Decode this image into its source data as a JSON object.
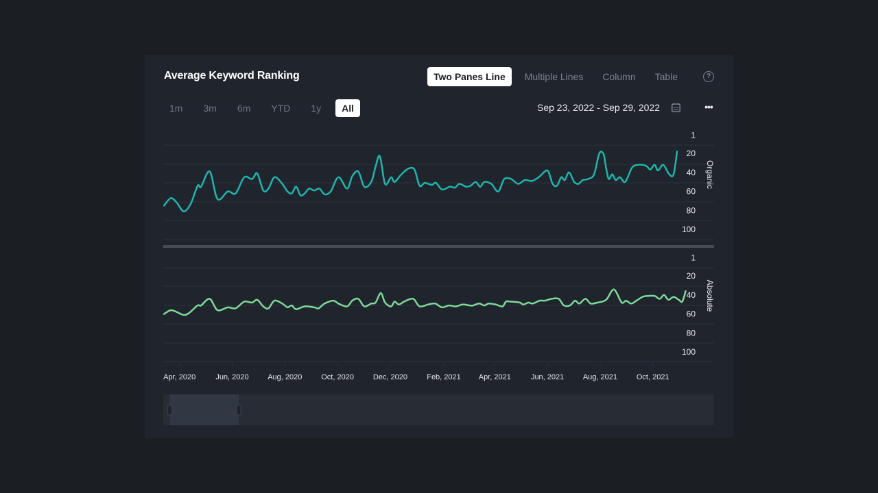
{
  "card": {
    "title": "Average Keyword Ranking",
    "view_tabs": [
      {
        "label": "Two Panes Line",
        "active": true
      },
      {
        "label": "Multiple Lines",
        "active": false
      },
      {
        "label": "Column",
        "active": false
      },
      {
        "label": "Table",
        "active": false
      }
    ],
    "help_icon": "?",
    "range_tabs": [
      {
        "label": "1m",
        "active": false
      },
      {
        "label": "3m",
        "active": false
      },
      {
        "label": "6m",
        "active": false
      },
      {
        "label": "YTD",
        "active": false
      },
      {
        "label": "1y",
        "active": false
      },
      {
        "label": "All",
        "active": true
      }
    ],
    "date_range": "Sep 23, 2022 - Sep 29, 2022",
    "more_icon": "•••"
  },
  "colors": {
    "organic": "#1fb5ad",
    "absolute": "#7ed99a",
    "grid": "#2c313b",
    "separator": "#464b5a",
    "navigator_bg": "#272c35",
    "navigator_window": "#323843"
  },
  "chart_data": {
    "type": "line",
    "title": "Average Keyword Ranking",
    "x_range": [
      "2020-03-14",
      "2021-10-29"
    ],
    "x_ticks": [
      "Apr, 2020",
      "Jun, 2020",
      "Aug, 2020",
      "Oct, 2020",
      "Dec, 2020",
      "Feb, 2021",
      "Apr, 2021",
      "Jun, 2021",
      "Aug, 2021",
      "Oct, 2021"
    ],
    "x_tick_dates": [
      "2020-04-01",
      "2020-06-01",
      "2020-08-01",
      "2020-10-01",
      "2020-12-01",
      "2021-02-01",
      "2021-04-01",
      "2021-06-01",
      "2021-08-01",
      "2021-10-01"
    ],
    "grid": true,
    "navigator": {
      "window_start_fraction": 0.012,
      "window_end_fraction": 0.137
    },
    "panes": [
      {
        "name": "Organic",
        "ylabel": "Organic",
        "y_reversed": true,
        "y_ticks": [
          1,
          20,
          40,
          60,
          80,
          100
        ],
        "ylim": [
          1,
          100
        ],
        "series": {
          "name": "Organic",
          "points": [
            [
              "2020-03-14",
              75
            ],
            [
              "2020-03-22",
              67
            ],
            [
              "2020-03-29",
              72
            ],
            [
              "2020-04-06",
              81
            ],
            [
              "2020-04-14",
              73
            ],
            [
              "2020-04-22",
              54
            ],
            [
              "2020-04-26",
              55
            ],
            [
              "2020-05-06",
              39
            ],
            [
              "2020-05-15",
              68
            ],
            [
              "2020-05-27",
              60
            ],
            [
              "2020-06-05",
              62
            ],
            [
              "2020-06-15",
              45
            ],
            [
              "2020-06-24",
              47
            ],
            [
              "2020-06-30",
              41
            ],
            [
              "2020-07-07",
              59
            ],
            [
              "2020-07-13",
              57
            ],
            [
              "2020-07-20",
              45
            ],
            [
              "2020-07-29",
              52
            ],
            [
              "2020-08-04",
              60
            ],
            [
              "2020-08-09",
              62
            ],
            [
              "2020-08-14",
              55
            ],
            [
              "2020-08-19",
              64
            ],
            [
              "2020-08-24",
              62
            ],
            [
              "2020-08-29",
              57
            ],
            [
              "2020-09-04",
              59
            ],
            [
              "2020-09-10",
              57
            ],
            [
              "2020-09-16",
              63
            ],
            [
              "2020-09-23",
              60
            ],
            [
              "2020-10-02",
              45
            ],
            [
              "2020-10-12",
              57
            ],
            [
              "2020-10-18",
              44
            ],
            [
              "2020-10-25",
              39
            ],
            [
              "2020-11-01",
              55
            ],
            [
              "2020-11-09",
              50
            ],
            [
              "2020-11-14",
              34
            ],
            [
              "2020-11-19",
              23
            ],
            [
              "2020-11-25",
              52
            ],
            [
              "2020-12-02",
              45
            ],
            [
              "2020-12-06",
              50
            ],
            [
              "2020-12-14",
              42
            ],
            [
              "2020-12-22",
              36
            ],
            [
              "2020-12-29",
              37
            ],
            [
              "2021-01-04",
              54
            ],
            [
              "2021-01-10",
              51
            ],
            [
              "2021-01-18",
              53
            ],
            [
              "2021-01-23",
              51
            ],
            [
              "2021-01-30",
              58
            ],
            [
              "2021-02-08",
              55
            ],
            [
              "2021-02-14",
              56
            ],
            [
              "2021-02-19",
              52
            ],
            [
              "2021-02-27",
              55
            ],
            [
              "2021-03-04",
              54
            ],
            [
              "2021-03-10",
              50
            ],
            [
              "2021-03-15",
              55
            ],
            [
              "2021-03-20",
              50
            ],
            [
              "2021-03-28",
              52
            ],
            [
              "2021-04-05",
              60
            ],
            [
              "2021-04-12",
              47
            ],
            [
              "2021-04-20",
              47
            ],
            [
              "2021-04-28",
              52
            ],
            [
              "2021-05-06",
              48
            ],
            [
              "2021-05-14",
              49
            ],
            [
              "2021-05-22",
              45
            ],
            [
              "2021-05-29",
              39
            ],
            [
              "2021-06-02",
              39
            ],
            [
              "2021-06-07",
              52
            ],
            [
              "2021-06-12",
              54
            ],
            [
              "2021-06-17",
              45
            ],
            [
              "2021-06-21",
              48
            ],
            [
              "2021-06-26",
              40
            ],
            [
              "2021-07-02",
              50
            ],
            [
              "2021-07-07",
              52
            ],
            [
              "2021-07-12",
              48
            ],
            [
              "2021-07-18",
              47
            ],
            [
              "2021-07-25",
              42
            ],
            [
              "2021-07-31",
              20
            ],
            [
              "2021-08-05",
              21
            ],
            [
              "2021-08-08",
              36
            ],
            [
              "2021-08-11",
              47
            ],
            [
              "2021-08-15",
              42
            ],
            [
              "2021-08-19",
              48
            ],
            [
              "2021-08-24",
              45
            ],
            [
              "2021-08-30",
              50
            ],
            [
              "2021-09-07",
              35
            ],
            [
              "2021-09-14",
              32
            ],
            [
              "2021-09-23",
              33
            ],
            [
              "2021-09-28",
              37
            ],
            [
              "2021-10-03",
              32
            ],
            [
              "2021-10-07",
              38
            ],
            [
              "2021-10-13",
              32
            ],
            [
              "2021-10-20",
              42
            ],
            [
              "2021-10-25",
              42
            ],
            [
              "2021-10-29",
              18
            ]
          ]
        }
      },
      {
        "name": "Absolute",
        "ylabel": "Absolute",
        "y_reversed": true,
        "y_ticks": [
          1,
          20,
          40,
          60,
          80,
          100
        ],
        "ylim": [
          1,
          100
        ],
        "series": {
          "name": "Absolute",
          "points": [
            [
              "2020-03-14",
              60
            ],
            [
              "2020-03-22",
              56
            ],
            [
              "2020-03-29",
              58
            ],
            [
              "2020-04-06",
              61
            ],
            [
              "2020-04-12",
              59
            ],
            [
              "2020-04-22",
              51
            ],
            [
              "2020-04-26",
              51
            ],
            [
              "2020-05-06",
              44
            ],
            [
              "2020-05-15",
              56
            ],
            [
              "2020-05-27",
              53
            ],
            [
              "2020-06-05",
              54
            ],
            [
              "2020-06-15",
              47
            ],
            [
              "2020-06-24",
              48
            ],
            [
              "2020-06-30",
              45
            ],
            [
              "2020-07-07",
              52
            ],
            [
              "2020-07-13",
              54
            ],
            [
              "2020-07-20",
              46
            ],
            [
              "2020-07-29",
              49
            ],
            [
              "2020-08-04",
              53
            ],
            [
              "2020-08-09",
              51
            ],
            [
              "2020-08-14",
              55
            ],
            [
              "2020-08-24",
              52
            ],
            [
              "2020-09-04",
              53
            ],
            [
              "2020-09-09",
              54
            ],
            [
              "2020-09-16",
              49
            ],
            [
              "2020-09-26",
              46
            ],
            [
              "2020-10-02",
              49
            ],
            [
              "2020-10-12",
              52
            ],
            [
              "2020-10-18",
              46
            ],
            [
              "2020-10-25",
              44
            ],
            [
              "2020-11-01",
              52
            ],
            [
              "2020-11-09",
              49
            ],
            [
              "2020-11-14",
              48
            ],
            [
              "2020-11-20",
              38
            ],
            [
              "2020-11-25",
              48
            ],
            [
              "2020-12-02",
              52
            ],
            [
              "2020-12-06",
              47
            ],
            [
              "2020-12-11",
              50
            ],
            [
              "2020-12-17",
              47
            ],
            [
              "2020-12-25",
              44
            ],
            [
              "2020-12-29",
              45
            ],
            [
              "2021-01-04",
              52
            ],
            [
              "2021-01-14",
              50
            ],
            [
              "2021-01-22",
              49
            ],
            [
              "2021-01-30",
              53
            ],
            [
              "2021-02-07",
              51
            ],
            [
              "2021-02-15",
              52
            ],
            [
              "2021-02-23",
              50
            ],
            [
              "2021-03-03",
              51
            ],
            [
              "2021-03-07",
              51
            ],
            [
              "2021-03-14",
              49
            ],
            [
              "2021-03-20",
              51
            ],
            [
              "2021-03-25",
              49
            ],
            [
              "2021-04-02",
              50
            ],
            [
              "2021-04-10",
              52
            ],
            [
              "2021-04-14",
              47
            ],
            [
              "2021-04-20",
              47
            ],
            [
              "2021-04-30",
              48
            ],
            [
              "2021-05-04",
              50
            ],
            [
              "2021-05-10",
              48
            ],
            [
              "2021-05-15",
              49
            ],
            [
              "2021-05-23",
              46
            ],
            [
              "2021-05-29",
              46
            ],
            [
              "2021-06-06",
              44
            ],
            [
              "2021-06-14",
              44
            ],
            [
              "2021-06-20",
              51
            ],
            [
              "2021-06-27",
              51
            ],
            [
              "2021-07-03",
              46
            ],
            [
              "2021-07-08",
              49
            ],
            [
              "2021-07-15",
              44
            ],
            [
              "2021-07-21",
              49
            ],
            [
              "2021-07-29",
              48
            ],
            [
              "2021-08-08",
              45
            ],
            [
              "2021-08-15",
              35
            ],
            [
              "2021-08-19",
              36
            ],
            [
              "2021-08-26",
              48
            ],
            [
              "2021-08-31",
              46
            ],
            [
              "2021-09-06",
              49
            ],
            [
              "2021-09-12",
              46
            ],
            [
              "2021-09-19",
              42
            ],
            [
              "2021-09-25",
              41
            ],
            [
              "2021-10-03",
              41
            ],
            [
              "2021-10-09",
              44
            ],
            [
              "2021-10-14",
              40
            ],
            [
              "2021-10-19",
              45
            ],
            [
              "2021-10-25",
              42
            ],
            [
              "2021-10-31",
              45
            ],
            [
              "2021-11-04",
              47
            ],
            [
              "2021-11-08",
              36
            ]
          ]
        }
      }
    ]
  }
}
